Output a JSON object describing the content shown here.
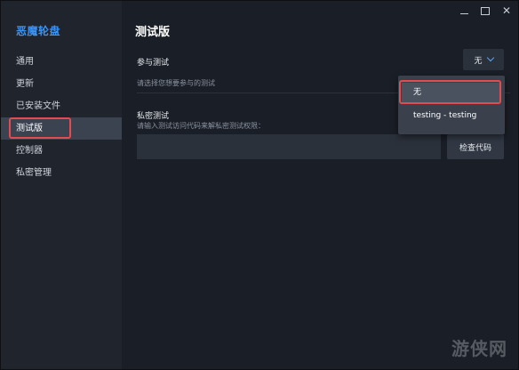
{
  "window": {
    "controls": [
      "minimize",
      "maximize",
      "close"
    ],
    "close_glyph": "✕"
  },
  "sidebar": {
    "app_title": "恶魔轮盘",
    "items": [
      {
        "label": "通用"
      },
      {
        "label": "更新"
      },
      {
        "label": "已安装文件"
      },
      {
        "label": "测试版",
        "active": true
      },
      {
        "label": "控制器"
      },
      {
        "label": "私密管理"
      }
    ]
  },
  "main": {
    "page_title": "测试版",
    "participate": {
      "label": "参与测试",
      "hint": "请选择您想要参与的测试",
      "selected_value": "无"
    },
    "private": {
      "label": "私密测试",
      "hint": "请输入测试访问代码来解私密测试权限：",
      "input_value": "",
      "input_placeholder": "",
      "check_button_label": "检查代码"
    }
  },
  "dropdown": {
    "options": [
      {
        "label": "无",
        "selected": true
      },
      {
        "label": "testing - testing",
        "selected": false
      }
    ]
  },
  "watermark": "游侠网",
  "colors": {
    "accent": "#3b93f4",
    "highlight_border": "#e24b50",
    "sidebar_bg": "#1f242d",
    "main_bg": "#1a1e26",
    "active_item_bg": "#3b4350"
  }
}
